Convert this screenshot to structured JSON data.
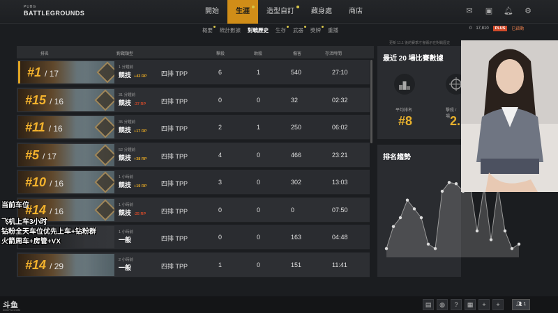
{
  "logo": {
    "small": "PUBG",
    "main": "BATTLEGROUNDS"
  },
  "nav": [
    {
      "label": "開始",
      "active": false,
      "dot": false
    },
    {
      "label": "生涯",
      "active": true,
      "dot": true
    },
    {
      "label": "造型自訂",
      "active": false,
      "dot": true
    },
    {
      "label": "藏身處",
      "active": false,
      "dot": false
    },
    {
      "label": "商店",
      "active": false,
      "dot": false
    }
  ],
  "subnav": [
    {
      "label": "概要",
      "active": false,
      "dot": true
    },
    {
      "label": "統計數據",
      "active": false,
      "dot": false
    },
    {
      "label": "對戰歷史",
      "active": true,
      "dot": false
    },
    {
      "label": "生存",
      "active": false,
      "dot": true
    },
    {
      "label": "武器",
      "active": false,
      "dot": true
    },
    {
      "label": "獎牌",
      "active": false,
      "dot": true
    },
    {
      "label": "重播",
      "active": false,
      "dot": false
    }
  ],
  "currency": {
    "coin": "0",
    "bp": "17,810",
    "plus": "PLUS",
    "status": "已啟動"
  },
  "notice": "更新 11.1 後的賽季才會顯示在對戰歷史",
  "table": {
    "headers": {
      "rank": "排名",
      "type": "對戰類型",
      "kills": "擊殺",
      "assists": "助殺",
      "damage": "傷害",
      "survival": "存活時間"
    },
    "rows": [
      {
        "rank": "#1",
        "total": "/ 17",
        "time": "1 分鐘前",
        "mode": "競技",
        "rp": "+43 RP",
        "rp_sign": "pos",
        "squad": "四排 TPP",
        "kills": "6",
        "assists": "1",
        "damage": "540",
        "survival": "27:10",
        "gold": true
      },
      {
        "rank": "#15",
        "total": "/ 16",
        "time": "31 分鐘前",
        "mode": "競技",
        "rp": "-37 RP",
        "rp_sign": "neg",
        "squad": "四排 TPP",
        "kills": "0",
        "assists": "0",
        "damage": "32",
        "survival": "02:32",
        "gold": false
      },
      {
        "rank": "#11",
        "total": "/ 16",
        "time": "35 分鐘前",
        "mode": "競技",
        "rp": "+17 RP",
        "rp_sign": "pos",
        "squad": "四排 TPP",
        "kills": "2",
        "assists": "1",
        "damage": "250",
        "survival": "06:02",
        "gold": false
      },
      {
        "rank": "#5",
        "total": "/ 17",
        "time": "52 分鐘前",
        "mode": "競技",
        "rp": "+38 RP",
        "rp_sign": "pos",
        "squad": "四排 TPP",
        "kills": "4",
        "assists": "0",
        "damage": "466",
        "survival": "23:21",
        "gold": false
      },
      {
        "rank": "#10",
        "total": "/ 16",
        "time": "1 小時前",
        "mode": "競技",
        "rp": "+19 RP",
        "rp_sign": "pos",
        "squad": "四排 TPP",
        "kills": "3",
        "assists": "0",
        "damage": "302",
        "survival": "13:03",
        "gold": false
      },
      {
        "rank": "#14",
        "total": "/ 16",
        "time": "1 小時前",
        "mode": "競技",
        "rp": "-25 RP",
        "rp_sign": "neg",
        "squad": "四排 TPP",
        "kills": "0",
        "assists": "0",
        "damage": "0",
        "survival": "07:50",
        "gold": false
      },
      {
        "rank": "",
        "total": "",
        "time": "1 小時前",
        "mode": "一般",
        "rp": "",
        "rp_sign": "pos",
        "squad": "四排 TPP",
        "kills": "0",
        "assists": "0",
        "damage": "163",
        "survival": "04:48",
        "gold": false
      },
      {
        "rank": "#14",
        "total": "/ 29",
        "time": "2 小時前",
        "mode": "一般",
        "rp": "",
        "rp_sign": "pos",
        "squad": "四排 TPP",
        "kills": "1",
        "assists": "0",
        "damage": "151",
        "survival": "11:41",
        "gold": false
      }
    ]
  },
  "panel": {
    "title": "最近 20 場比賽數據",
    "avg_rank_label": "平均排名",
    "avg_rank": "#8",
    "kills_label": "擊殺 / 場",
    "kills_value": "2.1",
    "trend_title": "排名趨勢"
  },
  "chart_data": {
    "type": "line",
    "title": "排名趨勢",
    "x": [
      1,
      2,
      3,
      4,
      5,
      6,
      7,
      8,
      9,
      10,
      11,
      12,
      13,
      14,
      15,
      16,
      17,
      18,
      19,
      20
    ],
    "series": [
      {
        "values": [
          16,
          11,
          9,
          5,
          7,
          9,
          15,
          16,
          3,
          1,
          1.3,
          3,
          1.5,
          12,
          2,
          14,
          2,
          12,
          16,
          15
        ]
      }
    ],
    "ylim": [
      18,
      0
    ],
    "grid": false,
    "color": "#9a9a9a"
  },
  "overlay": {
    "line1": "当前车位",
    "line2": "飞机上车3小时",
    "line3": "钻粉全天车位优先上车+钻粉群",
    "line4": "火箭周车+房管+VX"
  },
  "brand": {
    "name": "斗鱼",
    "sub": "DOUYU.COM"
  },
  "bottom": {
    "help": "?",
    "party_count": "1"
  }
}
